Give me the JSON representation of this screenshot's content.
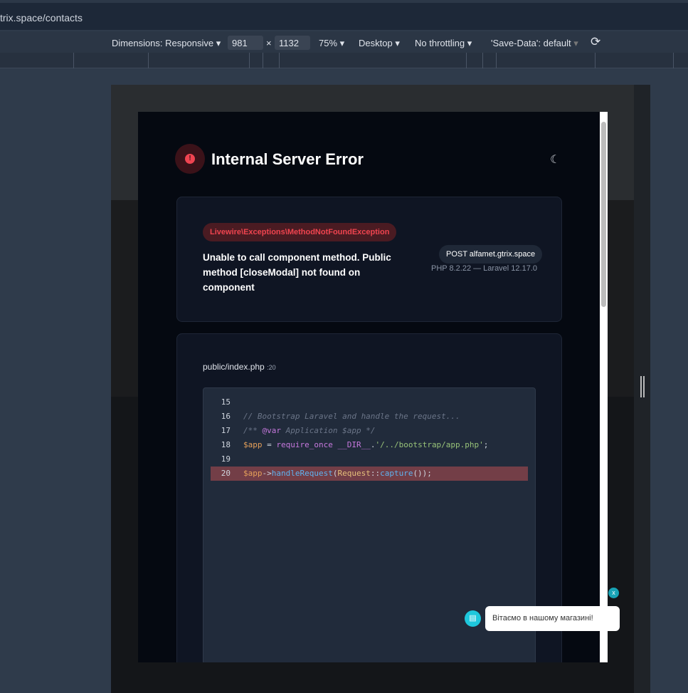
{
  "browser": {
    "url": "trix.space/contacts"
  },
  "devtools": {
    "dimensions_label": "Dimensions: Responsive",
    "width": "981",
    "height": "1132",
    "times": "×",
    "zoom": "75%",
    "device": "Desktop",
    "throttling": "No throttling",
    "save_data": "'Save-Data': default"
  },
  "error": {
    "title": "Internal Server Error",
    "exception": "Livewire\\Exceptions\\MethodNotFoundException",
    "message": "Unable to call component method. Public method [closeModal] not found on component",
    "request": "POST alfamet.gtrix.space",
    "versions": "PHP 8.2.22 — Laravel 12.17.0"
  },
  "frame": {
    "file": "public/index.php",
    "line": ":20",
    "lines": [
      {
        "n": "15",
        "parts": []
      },
      {
        "n": "16",
        "parts": [
          {
            "t": "// Bootstrap Laravel and handle the request...",
            "k": "cm"
          }
        ]
      },
      {
        "n": "17",
        "parts": [
          {
            "t": "/** ",
            "k": "cm"
          },
          {
            "t": "@var",
            "k": "kw"
          },
          {
            "t": " Application $app */",
            "k": "cm"
          }
        ]
      },
      {
        "n": "18",
        "parts": [
          {
            "t": "$app",
            "k": "var"
          },
          {
            "t": " = ",
            "k": "pl"
          },
          {
            "t": "require_once",
            "k": "kw"
          },
          {
            "t": " ",
            "k": "pl"
          },
          {
            "t": "__DIR__",
            "k": "kw"
          },
          {
            "t": ".",
            "k": "pl"
          },
          {
            "t": "'/../bootstrap/app.php'",
            "k": "str"
          },
          {
            "t": ";",
            "k": "pl"
          }
        ]
      },
      {
        "n": "19",
        "parts": []
      },
      {
        "n": "20",
        "hl": true,
        "parts": [
          {
            "t": "$app",
            "k": "var"
          },
          {
            "t": "->",
            "k": "pl"
          },
          {
            "t": "handleRequest",
            "k": "fn"
          },
          {
            "t": "(",
            "k": "pl"
          },
          {
            "t": "Request",
            "k": "cls"
          },
          {
            "t": "::",
            "k": "pl"
          },
          {
            "t": "capture",
            "k": "fn"
          },
          {
            "t": "());",
            "k": "pl"
          }
        ]
      }
    ]
  },
  "chat": {
    "close": "x",
    "greeting": "Вітаємо в нашому магазині!"
  }
}
